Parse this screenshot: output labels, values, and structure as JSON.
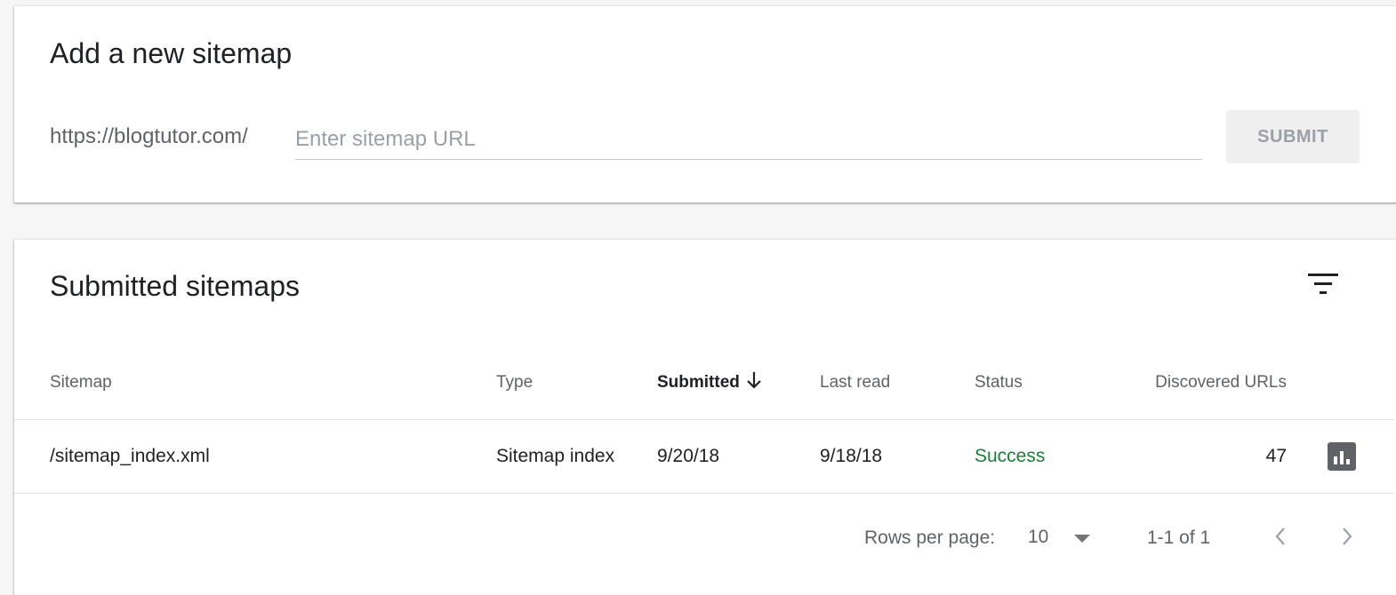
{
  "add_sitemap": {
    "title": "Add a new sitemap",
    "url_prefix": "https://blogtutor.com/",
    "input_placeholder": "Enter sitemap URL",
    "input_value": "",
    "submit_label": "SUBMIT"
  },
  "submitted": {
    "title": "Submitted sitemaps",
    "columns": {
      "sitemap": "Sitemap",
      "type": "Type",
      "submitted": "Submitted",
      "last_read": "Last read",
      "status": "Status",
      "discovered_urls": "Discovered URLs"
    },
    "sort": {
      "column": "submitted",
      "direction": "descending"
    },
    "rows": [
      {
        "sitemap": "/sitemap_index.xml",
        "type": "Sitemap index",
        "submitted": "9/20/18",
        "last_read": "9/18/18",
        "status": "Success",
        "discovered_urls": "47"
      }
    ]
  },
  "pagination": {
    "rows_per_page_label": "Rows per page:",
    "rows_per_page_value": "10",
    "range_label": "1-1 of 1"
  },
  "icons": [
    "filter-icon",
    "arrow-down-icon",
    "bar-chart-icon",
    "caret-down-icon",
    "chevron-left-icon",
    "chevron-right-icon"
  ],
  "colors": {
    "background": "#f6f6f6",
    "card": "#ffffff",
    "success": "#188038",
    "muted_text": "#5f6368",
    "submit_button_bg": "#efefef"
  }
}
